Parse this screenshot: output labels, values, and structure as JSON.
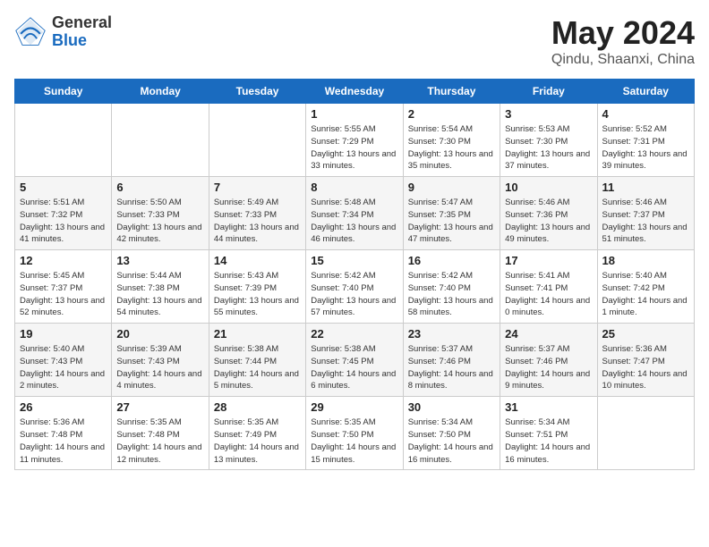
{
  "header": {
    "logo_general": "General",
    "logo_blue": "Blue",
    "month_year": "May 2024",
    "location": "Qindu, Shaanxi, China"
  },
  "weekdays": [
    "Sunday",
    "Monday",
    "Tuesday",
    "Wednesday",
    "Thursday",
    "Friday",
    "Saturday"
  ],
  "weeks": [
    [
      {
        "day": "",
        "sunrise": "",
        "sunset": "",
        "daylight": ""
      },
      {
        "day": "",
        "sunrise": "",
        "sunset": "",
        "daylight": ""
      },
      {
        "day": "",
        "sunrise": "",
        "sunset": "",
        "daylight": ""
      },
      {
        "day": "1",
        "sunrise": "Sunrise: 5:55 AM",
        "sunset": "Sunset: 7:29 PM",
        "daylight": "Daylight: 13 hours and 33 minutes."
      },
      {
        "day": "2",
        "sunrise": "Sunrise: 5:54 AM",
        "sunset": "Sunset: 7:30 PM",
        "daylight": "Daylight: 13 hours and 35 minutes."
      },
      {
        "day": "3",
        "sunrise": "Sunrise: 5:53 AM",
        "sunset": "Sunset: 7:30 PM",
        "daylight": "Daylight: 13 hours and 37 minutes."
      },
      {
        "day": "4",
        "sunrise": "Sunrise: 5:52 AM",
        "sunset": "Sunset: 7:31 PM",
        "daylight": "Daylight: 13 hours and 39 minutes."
      }
    ],
    [
      {
        "day": "5",
        "sunrise": "Sunrise: 5:51 AM",
        "sunset": "Sunset: 7:32 PM",
        "daylight": "Daylight: 13 hours and 41 minutes."
      },
      {
        "day": "6",
        "sunrise": "Sunrise: 5:50 AM",
        "sunset": "Sunset: 7:33 PM",
        "daylight": "Daylight: 13 hours and 42 minutes."
      },
      {
        "day": "7",
        "sunrise": "Sunrise: 5:49 AM",
        "sunset": "Sunset: 7:33 PM",
        "daylight": "Daylight: 13 hours and 44 minutes."
      },
      {
        "day": "8",
        "sunrise": "Sunrise: 5:48 AM",
        "sunset": "Sunset: 7:34 PM",
        "daylight": "Daylight: 13 hours and 46 minutes."
      },
      {
        "day": "9",
        "sunrise": "Sunrise: 5:47 AM",
        "sunset": "Sunset: 7:35 PM",
        "daylight": "Daylight: 13 hours and 47 minutes."
      },
      {
        "day": "10",
        "sunrise": "Sunrise: 5:46 AM",
        "sunset": "Sunset: 7:36 PM",
        "daylight": "Daylight: 13 hours and 49 minutes."
      },
      {
        "day": "11",
        "sunrise": "Sunrise: 5:46 AM",
        "sunset": "Sunset: 7:37 PM",
        "daylight": "Daylight: 13 hours and 51 minutes."
      }
    ],
    [
      {
        "day": "12",
        "sunrise": "Sunrise: 5:45 AM",
        "sunset": "Sunset: 7:37 PM",
        "daylight": "Daylight: 13 hours and 52 minutes."
      },
      {
        "day": "13",
        "sunrise": "Sunrise: 5:44 AM",
        "sunset": "Sunset: 7:38 PM",
        "daylight": "Daylight: 13 hours and 54 minutes."
      },
      {
        "day": "14",
        "sunrise": "Sunrise: 5:43 AM",
        "sunset": "Sunset: 7:39 PM",
        "daylight": "Daylight: 13 hours and 55 minutes."
      },
      {
        "day": "15",
        "sunrise": "Sunrise: 5:42 AM",
        "sunset": "Sunset: 7:40 PM",
        "daylight": "Daylight: 13 hours and 57 minutes."
      },
      {
        "day": "16",
        "sunrise": "Sunrise: 5:42 AM",
        "sunset": "Sunset: 7:40 PM",
        "daylight": "Daylight: 13 hours and 58 minutes."
      },
      {
        "day": "17",
        "sunrise": "Sunrise: 5:41 AM",
        "sunset": "Sunset: 7:41 PM",
        "daylight": "Daylight: 14 hours and 0 minutes."
      },
      {
        "day": "18",
        "sunrise": "Sunrise: 5:40 AM",
        "sunset": "Sunset: 7:42 PM",
        "daylight": "Daylight: 14 hours and 1 minute."
      }
    ],
    [
      {
        "day": "19",
        "sunrise": "Sunrise: 5:40 AM",
        "sunset": "Sunset: 7:43 PM",
        "daylight": "Daylight: 14 hours and 2 minutes."
      },
      {
        "day": "20",
        "sunrise": "Sunrise: 5:39 AM",
        "sunset": "Sunset: 7:43 PM",
        "daylight": "Daylight: 14 hours and 4 minutes."
      },
      {
        "day": "21",
        "sunrise": "Sunrise: 5:38 AM",
        "sunset": "Sunset: 7:44 PM",
        "daylight": "Daylight: 14 hours and 5 minutes."
      },
      {
        "day": "22",
        "sunrise": "Sunrise: 5:38 AM",
        "sunset": "Sunset: 7:45 PM",
        "daylight": "Daylight: 14 hours and 6 minutes."
      },
      {
        "day": "23",
        "sunrise": "Sunrise: 5:37 AM",
        "sunset": "Sunset: 7:46 PM",
        "daylight": "Daylight: 14 hours and 8 minutes."
      },
      {
        "day": "24",
        "sunrise": "Sunrise: 5:37 AM",
        "sunset": "Sunset: 7:46 PM",
        "daylight": "Daylight: 14 hours and 9 minutes."
      },
      {
        "day": "25",
        "sunrise": "Sunrise: 5:36 AM",
        "sunset": "Sunset: 7:47 PM",
        "daylight": "Daylight: 14 hours and 10 minutes."
      }
    ],
    [
      {
        "day": "26",
        "sunrise": "Sunrise: 5:36 AM",
        "sunset": "Sunset: 7:48 PM",
        "daylight": "Daylight: 14 hours and 11 minutes."
      },
      {
        "day": "27",
        "sunrise": "Sunrise: 5:35 AM",
        "sunset": "Sunset: 7:48 PM",
        "daylight": "Daylight: 14 hours and 12 minutes."
      },
      {
        "day": "28",
        "sunrise": "Sunrise: 5:35 AM",
        "sunset": "Sunset: 7:49 PM",
        "daylight": "Daylight: 14 hours and 13 minutes."
      },
      {
        "day": "29",
        "sunrise": "Sunrise: 5:35 AM",
        "sunset": "Sunset: 7:50 PM",
        "daylight": "Daylight: 14 hours and 15 minutes."
      },
      {
        "day": "30",
        "sunrise": "Sunrise: 5:34 AM",
        "sunset": "Sunset: 7:50 PM",
        "daylight": "Daylight: 14 hours and 16 minutes."
      },
      {
        "day": "31",
        "sunrise": "Sunrise: 5:34 AM",
        "sunset": "Sunset: 7:51 PM",
        "daylight": "Daylight: 14 hours and 16 minutes."
      },
      {
        "day": "",
        "sunrise": "",
        "sunset": "",
        "daylight": ""
      }
    ]
  ]
}
